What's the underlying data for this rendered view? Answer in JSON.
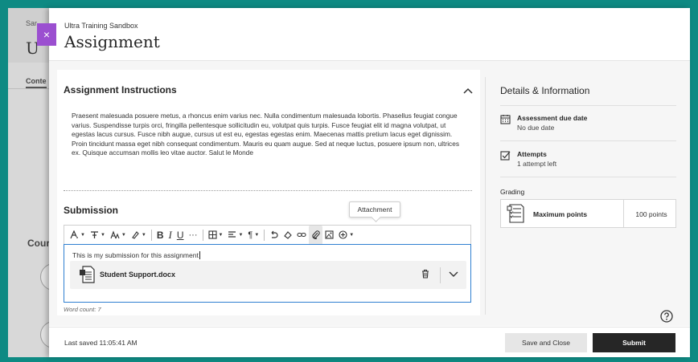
{
  "background": {
    "top_text": "Sar",
    "title_fragment": "U",
    "tab_fragment": "Conte",
    "course_fragment": "Cour"
  },
  "header": {
    "course_name": "Ultra Training Sandbox",
    "title": "Assignment",
    "close_glyph": "×"
  },
  "instructions": {
    "title": "Assignment Instructions",
    "body": "Praesent malesuada posuere metus, a rhoncus enim varius nec. Nulla condimentum malesuada lobortis. Phasellus feugiat congue varius. Suspendisse turpis orci, fringilla pellentesque sollicitudin eu, volutpat quis turpis. Fusce feugiat elit id magna volutpat, ut egestas lacus cursus. Fusce nibh augue, cursus ut est eu, egestas egestas enim. Maecenas mattis pretium lacus eget dignissim. Proin tincidunt massa eget nibh consequat condimentum. Mauris eu quam augue. Sed at neque luctus, posuere ipsum non, ultrices ex. Quisque accumsan mollis leo vitae auctor. Salut le Monde"
  },
  "submission": {
    "title": "Submission",
    "tooltip": "Attachment",
    "toolbar": {
      "bold": "B",
      "italic": "I",
      "underline": "U",
      "more": "···",
      "paragraph": "¶"
    },
    "editor_text": "This is my submission for this assignment",
    "attachment_name": "Student Support.docx",
    "word_count": "Word count: 7"
  },
  "details": {
    "title": "Details & Information",
    "due_label": "Assessment due date",
    "due_value": "No due date",
    "attempts_label": "Attempts",
    "attempts_value": "1 attempt left",
    "grading_label": "Grading",
    "max_points_label": "Maximum points",
    "max_points_value": "100 points"
  },
  "footer": {
    "last_saved": "Last saved 11:05:41 AM",
    "save_close": "Save and Close",
    "submit": "Submit"
  },
  "colors": {
    "frame": "#0e8a83",
    "close_tab": "#9b4fd0",
    "editor_border": "#2f7fd1",
    "submit_bg": "#262626"
  }
}
